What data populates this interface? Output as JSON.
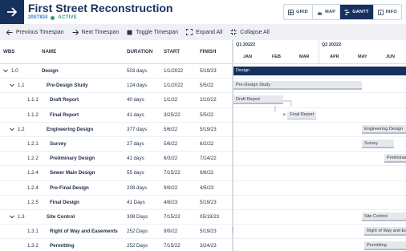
{
  "header": {
    "title": "First Street Reconstruction",
    "project_code": "20ST834",
    "status": "ACTIVE",
    "views": [
      {
        "label": "GRID",
        "icon": "grid-icon",
        "active": false
      },
      {
        "label": "MAP",
        "icon": "map-icon",
        "active": false
      },
      {
        "label": "GANTT",
        "icon": "gantt-icon",
        "active": true
      },
      {
        "label": "INFO",
        "icon": "info-icon",
        "active": false
      }
    ]
  },
  "toolbar": {
    "previous": "Previous Timespan",
    "next": "Next Timespan",
    "toggle": "Toggle Timespan",
    "expand": "Expand All",
    "collapse": "Collapse All"
  },
  "table": {
    "columns": {
      "wbs": "WBS",
      "name": "NAME",
      "duration": "DURATION",
      "start": "START",
      "finish": "FINISH"
    },
    "rows": [
      {
        "wbs": "1.0",
        "name": "Design",
        "duration": "503 days",
        "start": "1/1/2022",
        "finish": "5/19/23",
        "level": 0,
        "expandable": true
      },
      {
        "wbs": "1.1",
        "name": "Pre-Design Study",
        "duration": "124 days",
        "start": "1/1/2022",
        "finish": "5/5/22",
        "level": 1,
        "expandable": true
      },
      {
        "wbs": "1.1.1",
        "name": "Draft Report",
        "duration": "40 days",
        "start": "1/1/22",
        "finish": "2/10/22",
        "level": 2,
        "expandable": false
      },
      {
        "wbs": "1.1.2",
        "name": "Final Report",
        "duration": "41 days",
        "start": "3/25/22",
        "finish": "5/5/22",
        "level": 2,
        "expandable": false
      },
      {
        "wbs": "1.2",
        "name": "Engineering Design",
        "duration": "377 days",
        "start": "5/6/22",
        "finish": "5/19/23",
        "level": 1,
        "expandable": true
      },
      {
        "wbs": "1.2.1",
        "name": "Survey",
        "duration": "27 days",
        "start": "5/6/22",
        "finish": "6/2/22",
        "level": 2,
        "expandable": false
      },
      {
        "wbs": "1.2.2",
        "name": "Preliminary Design",
        "duration": "41 days",
        "start": "6/3/22",
        "finish": "7/14/22",
        "level": 2,
        "expandable": false
      },
      {
        "wbs": "1.2.4",
        "name": "Sewer Main Design",
        "duration": "55 days",
        "start": "7/15/22",
        "finish": "9/8/22",
        "level": 2,
        "expandable": false
      },
      {
        "wbs": "1.2.4",
        "name": "Pre-Final Design",
        "duration": "208 days",
        "start": "9/9/22",
        "finish": "4/5/23",
        "level": 2,
        "expandable": false
      },
      {
        "wbs": "1.2.5",
        "name": "Final Design",
        "duration": "41 Days",
        "start": "4/8/23",
        "finish": "5/19/23",
        "level": 2,
        "expandable": false
      },
      {
        "wbs": "1.3",
        "name": "Site Control",
        "duration": "308 Days",
        "start": "7/15/22",
        "finish": "05/19/23",
        "level": 1,
        "expandable": true
      },
      {
        "wbs": "1.3.1",
        "name": "Right of Way and Easements",
        "duration": "252 Days",
        "start": "9/9/22",
        "finish": "5/19/23",
        "level": 2,
        "expandable": false
      },
      {
        "wbs": "1.3.2",
        "name": "Permitting",
        "duration": "252 Days",
        "start": "7/15/22",
        "finish": "3/24/23",
        "level": 2,
        "expandable": false
      }
    ]
  },
  "gantt": {
    "quarters": [
      "Q1 20222",
      "Q2 20222"
    ],
    "months": [
      "JAN",
      "FEB",
      "MAR",
      "APR",
      "MAY",
      "JUN"
    ],
    "bars": [
      "Design",
      "Pre-Design Study",
      "Draft Report",
      "Final Report",
      "Engineering Design",
      "Survey",
      "Preliminary Design",
      "",
      "",
      "",
      "Site Control",
      "Right of Way and Easements",
      "Permitting"
    ]
  },
  "colors": {
    "brand": "#16315e",
    "accent": "#2a83c7",
    "active": "#2e9e78"
  }
}
